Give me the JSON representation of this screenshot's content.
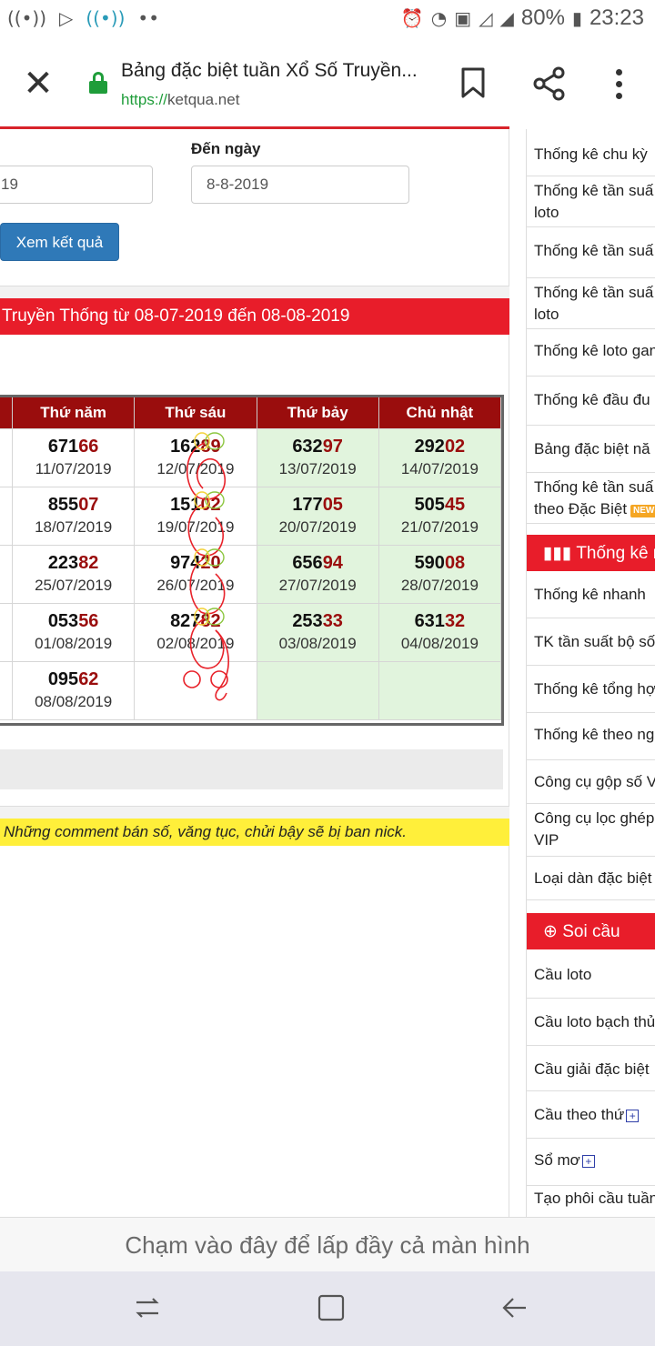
{
  "status_bar": {
    "battery": "80%",
    "time": "23:23",
    "icons": [
      "signal-tower-icon",
      "play-store-icon",
      "wifi-hotspot-icon",
      "more-dots-icon",
      "alarm-icon",
      "wifi-icon",
      "data-icon",
      "signal-icon",
      "battery-icon"
    ]
  },
  "toolbar": {
    "title": "Bảng đặc biệt tuần Xổ Số Truyền...",
    "url_scheme": "https://",
    "url_host": "ketqua.net"
  },
  "form": {
    "to_label": "Đến ngày",
    "from_value": "19",
    "to_value": "8-8-2019",
    "submit_label": "Xem kết quả"
  },
  "results_header": "Truyền Thống từ 08-07-2019 đến 08-08-2019",
  "table": {
    "columns": [
      "Thứ năm",
      "Thứ sáu",
      "Thứ bảy",
      "Chủ nhật"
    ],
    "rows": [
      [
        {
          "head": "671",
          "tail": "66",
          "date": "11/07/2019"
        },
        {
          "head": "162",
          "tail": "89",
          "date": "12/07/2019"
        },
        {
          "head": "632",
          "tail": "97",
          "date": "13/07/2019"
        },
        {
          "head": "292",
          "tail": "02",
          "date": "14/07/2019"
        }
      ],
      [
        {
          "head": "855",
          "tail": "07",
          "date": "18/07/2019"
        },
        {
          "head": "151",
          "tail": "02",
          "date": "19/07/2019"
        },
        {
          "head": "177",
          "tail": "05",
          "date": "20/07/2019"
        },
        {
          "head": "505",
          "tail": "45",
          "date": "21/07/2019"
        }
      ],
      [
        {
          "head": "223",
          "tail": "82",
          "date": "25/07/2019"
        },
        {
          "head": "974",
          "tail": "20",
          "date": "26/07/2019"
        },
        {
          "head": "656",
          "tail": "94",
          "date": "27/07/2019"
        },
        {
          "head": "590",
          "tail": "08",
          "date": "28/07/2019"
        }
      ],
      [
        {
          "head": "053",
          "tail": "56",
          "date": "01/08/2019"
        },
        {
          "head": "827",
          "tail": "82",
          "date": "02/08/2019"
        },
        {
          "head": "253",
          "tail": "33",
          "date": "03/08/2019"
        },
        {
          "head": "631",
          "tail": "32",
          "date": "04/08/2019"
        }
      ],
      [
        {
          "head": "095",
          "tail": "62",
          "date": "08/08/2019"
        },
        {
          "head": "",
          "tail": "",
          "date": ""
        },
        {
          "head": "",
          "tail": "",
          "date": ""
        },
        {
          "head": "",
          "tail": "",
          "date": ""
        }
      ]
    ]
  },
  "warning": "Những comment bán số, văng tục, chửi bậy sẽ bị ban nick.",
  "sidebar": {
    "items_top": [
      "Thống kê chu kỳ",
      "Thống kê tần suấ loto",
      "Thống kê tần suấ",
      "Thống kê tần suấ loto",
      "Thống kê loto gan",
      "Thống kê đầu đu",
      "Bảng đặc biệt nă",
      "Thống kê tần suấ theo Đặc Biệt"
    ],
    "new_badge": "NEW",
    "section_stats": "Thống kê n",
    "items_stats": [
      "Thống kê nhanh",
      "TK tần suất bộ số",
      "Thống kê tổng hợ",
      "Thống kê theo ng",
      "Công cụ gộp số V",
      "Công cụ lọc ghép VIP",
      "Loại dàn đặc biệt"
    ],
    "section_soicau": "Soi cầu",
    "items_soicau": [
      "Cầu loto",
      "Cầu loto bạch thủ",
      "Cầu giải đặc biệt",
      "Cầu theo thứ",
      "Sổ mơ",
      "Tạo phôi cầu tuần"
    ]
  },
  "fill_screen_text": "Chạm vào đây để lấp đầy cả màn hình",
  "colors": {
    "brand_red": "#e81d2a",
    "header_dark_red": "#9a0d0d",
    "button_blue": "#2f79b8",
    "weekend_green": "#e1f4dd",
    "warning_yellow": "#ffef3a",
    "secure_green": "#1f9d3a"
  }
}
